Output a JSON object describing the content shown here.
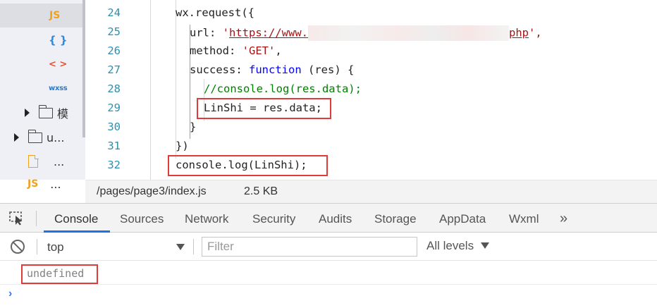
{
  "sidebar": {
    "items": [
      {
        "icon": "js-file-icon",
        "badge": "JS",
        "text": ""
      },
      {
        "icon": "json-file-icon",
        "badge": "{ }",
        "text": ""
      },
      {
        "icon": "wxml-file-icon",
        "badge": "< >",
        "text": ""
      },
      {
        "icon": "wxss-file-icon",
        "badge": "wxss",
        "text": ""
      },
      {
        "icon": "folder-icon",
        "badge": "",
        "text": "模"
      },
      {
        "icon": "folder-icon",
        "badge": "",
        "text": "u..."
      },
      {
        "icon": "file-icon",
        "badge": "",
        "text": "..."
      },
      {
        "icon": "js-file-icon",
        "badge": "JS",
        "text": "..."
      }
    ]
  },
  "editor": {
    "line_numbers": [
      "24",
      "25",
      "26",
      "27",
      "28",
      "29",
      "30",
      "31",
      "32"
    ],
    "code": {
      "l24": "wx.request({",
      "l25_key": "url: ",
      "l25_quote_open": "'",
      "l25_url_start": "https://www.",
      "l25_url_end": "php",
      "l25_quote_close": "',",
      "l26_key": "method: ",
      "l26_value": "'GET'",
      "l26_comma": ",",
      "l27_key": "success: ",
      "l27_keyword": "function",
      "l27_rest": " (res) {",
      "l28": "//console.log(res.data);",
      "l29": "LinShi = res.data;",
      "l30": "}",
      "l31": "})",
      "l32": "console.log(LinShi);"
    }
  },
  "status_bar": {
    "path": "/pages/page3/index.js",
    "size": "2.5 KB"
  },
  "devtools": {
    "tabs": [
      "Console",
      "Sources",
      "Network",
      "Security",
      "Audits",
      "Storage",
      "AppData",
      "Wxml"
    ],
    "active_tab": "Console",
    "more": "»"
  },
  "console_toolbar": {
    "context": "top",
    "filter_placeholder": "Filter",
    "levels": "All levels"
  },
  "console_output": {
    "message": "undefined",
    "prompt": "›"
  },
  "colors": {
    "highlight_box": "#e03b3b",
    "active_tab_underline": "#1a73e8",
    "line_numbers": "#2b91af",
    "string": "#a31515",
    "keyword": "#0000ff",
    "comment": "#008000"
  }
}
